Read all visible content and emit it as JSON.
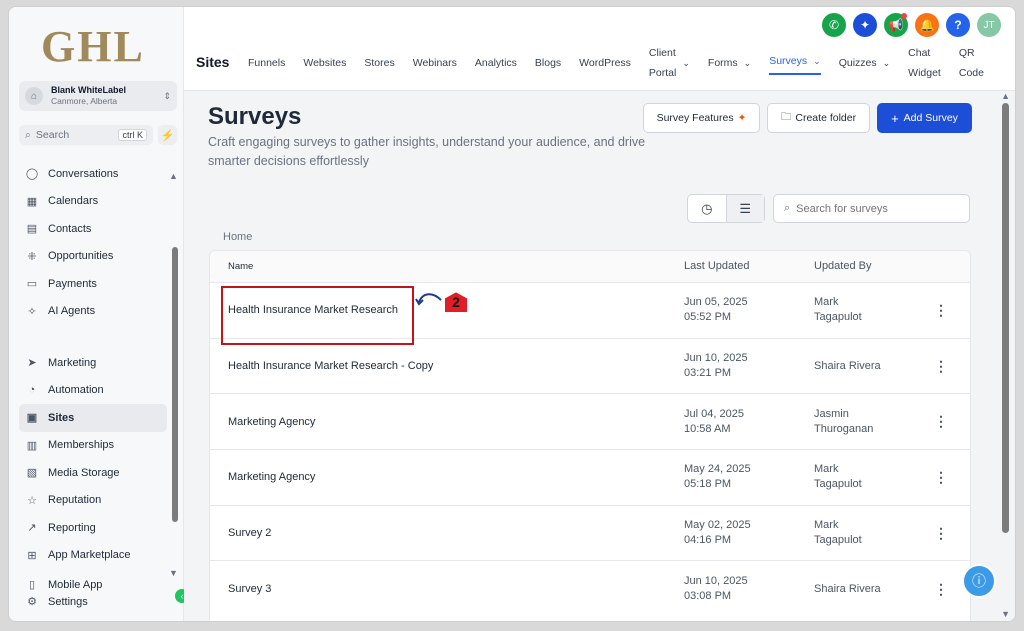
{
  "brand": {
    "logo_text": "GHL"
  },
  "account": {
    "name": "Blank WhiteLabel",
    "location": "Canmore, Alberta"
  },
  "sidebar": {
    "search_label": "Search",
    "search_shortcut": "ctrl K",
    "items_top": [
      {
        "label": "Conversations",
        "icon": "chat-icon"
      },
      {
        "label": "Calendars",
        "icon": "calendar-icon"
      },
      {
        "label": "Contacts",
        "icon": "contacts-icon"
      },
      {
        "label": "Opportunities",
        "icon": "opportunities-icon"
      },
      {
        "label": "Payments",
        "icon": "payments-icon"
      },
      {
        "label": "AI Agents",
        "icon": "sparkle-icon"
      }
    ],
    "items_bottom": [
      {
        "label": "Marketing",
        "icon": "send-icon"
      },
      {
        "label": "Automation",
        "icon": "automation-icon"
      },
      {
        "label": "Sites",
        "icon": "sites-icon",
        "active": true
      },
      {
        "label": "Memberships",
        "icon": "memberships-icon"
      },
      {
        "label": "Media Storage",
        "icon": "media-icon"
      },
      {
        "label": "Reputation",
        "icon": "star-icon"
      },
      {
        "label": "Reporting",
        "icon": "chart-icon"
      },
      {
        "label": "App Marketplace",
        "icon": "grid-icon"
      },
      {
        "label": "Mobile App",
        "icon": "mobile-icon"
      },
      {
        "label": "Settings",
        "icon": "gear-icon"
      }
    ]
  },
  "header": {
    "section": "Sites",
    "tabs": [
      {
        "label": "Funnels"
      },
      {
        "label": "Websites"
      },
      {
        "label": "Stores"
      },
      {
        "label": "Webinars"
      },
      {
        "label": "Analytics"
      },
      {
        "label": "Blogs"
      },
      {
        "label": "WordPress"
      },
      {
        "label": "Client Portal",
        "line1": "Client",
        "line2": "Portal",
        "dropdown": true
      },
      {
        "label": "Forms",
        "dropdown": true
      },
      {
        "label": "Surveys",
        "dropdown": true,
        "active": true
      },
      {
        "label": "Quizzes",
        "dropdown": true
      },
      {
        "label": "Chat Widget",
        "line1": "Chat",
        "line2": "Widget"
      },
      {
        "label": "QR Code",
        "line1": "QR",
        "line2": "Code"
      }
    ],
    "user_initials": "JT"
  },
  "page": {
    "title": "Surveys",
    "description": "Craft engaging surveys to gather insights, understand your audience, and drive smarter decisions effortlessly",
    "survey_features_label": "Survey Features",
    "create_folder_label": "Create folder",
    "add_survey_label": "Add Survey",
    "search_placeholder": "Search for surveys",
    "breadcrumb": "Home"
  },
  "table": {
    "headers": {
      "name": "Name",
      "updated": "Last Updated",
      "by": "Updated By"
    },
    "rows": [
      {
        "name": "Health Insurance Market Research",
        "date": "Jun 05, 2025",
        "time": "05:52 PM",
        "by1": "Mark",
        "by2": "Tagapulot"
      },
      {
        "name": "Health Insurance Market Research - Copy",
        "date": "Jun 10, 2025",
        "time": "03:21 PM",
        "by1": "Shaira Rivera",
        "by2": ""
      },
      {
        "name": "Marketing Agency",
        "date": "Jul 04, 2025",
        "time": "10:58 AM",
        "by1": "Jasmin",
        "by2": "Thuroganan"
      },
      {
        "name": "Marketing Agency",
        "date": "May 24, 2025",
        "time": "05:18 PM",
        "by1": "Mark",
        "by2": "Tagapulot"
      },
      {
        "name": "Survey 2",
        "date": "May 02, 2025",
        "time": "04:16 PM",
        "by1": "Mark",
        "by2": "Tagapulot"
      },
      {
        "name": "Survey 3",
        "date": "Jun 10, 2025",
        "time": "03:08 PM",
        "by1": "Shaira Rivera",
        "by2": ""
      }
    ]
  },
  "annotation": {
    "step": "2"
  },
  "colors": {
    "accent": "#2563eb",
    "primary_button": "#1d4ed8",
    "highlight": "#c0161b"
  }
}
